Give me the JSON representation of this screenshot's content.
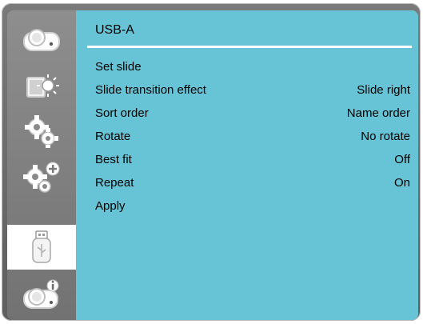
{
  "sidebar": {
    "items": [
      {
        "name": "projector-icon"
      },
      {
        "name": "picture-brightness-icon"
      },
      {
        "name": "settings-gears-icon"
      },
      {
        "name": "extended-settings-gears-plus-icon"
      },
      {
        "name": "usb-drive-icon",
        "active": true
      },
      {
        "name": "projector-info-icon"
      }
    ]
  },
  "main": {
    "title": "USB-A",
    "rows": [
      {
        "label": "Set slide",
        "value": ""
      },
      {
        "label": "Slide transition effect",
        "value": "Slide right"
      },
      {
        "label": "Sort order",
        "value": "Name order"
      },
      {
        "label": "Rotate",
        "value": "No rotate"
      },
      {
        "label": "Best fit",
        "value": "Off"
      },
      {
        "label": "Repeat",
        "value": "On"
      },
      {
        "label": "Apply",
        "value": ""
      }
    ]
  },
  "colors": {
    "panel": "#67c4d6",
    "sidebar": "#7f7f7f",
    "frame": "#6a6a6a"
  }
}
